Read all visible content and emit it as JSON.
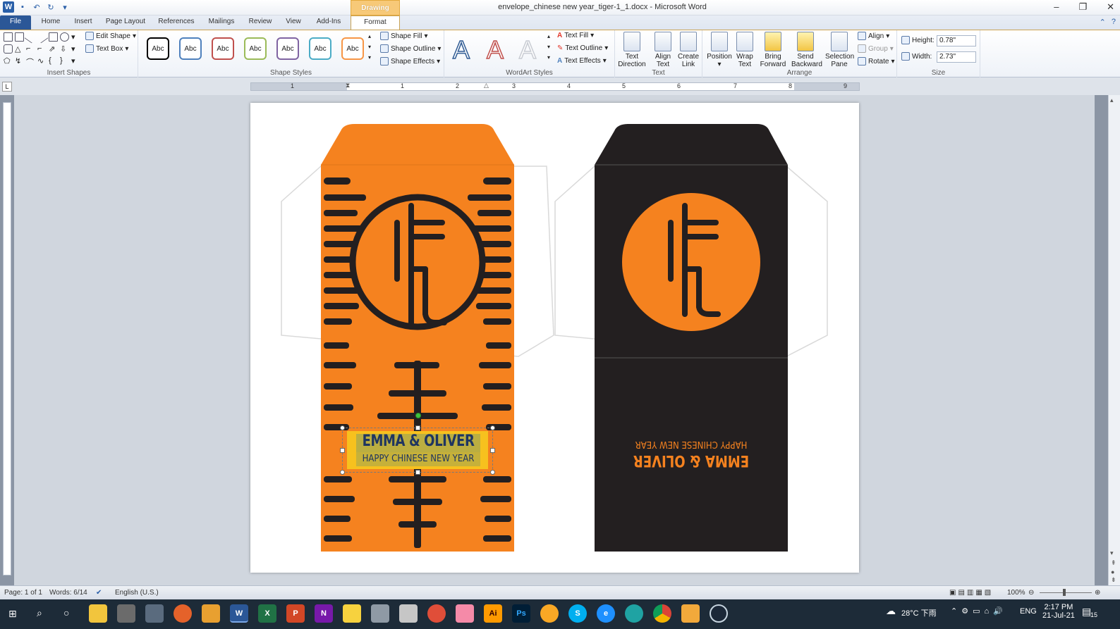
{
  "window": {
    "title": "envelope_chinese new year_tiger-1_1.docx  -  Microsoft Word",
    "contextual_tab_group": "Drawing Tools"
  },
  "tabs": [
    "File",
    "Home",
    "Insert",
    "Page Layout",
    "References",
    "Mailings",
    "Review",
    "View",
    "Add-Ins",
    "Format"
  ],
  "ribbon": {
    "insert_shapes": {
      "edit_shape": "Edit Shape",
      "text_box": "Text Box",
      "label": "Insert Shapes"
    },
    "shape_styles": {
      "samples": [
        "Abc",
        "Abc",
        "Abc",
        "Abc",
        "Abc",
        "Abc",
        "Abc"
      ],
      "sample_colors": [
        "#000000",
        "#4f81bd",
        "#c0504d",
        "#9bbb59",
        "#8064a2",
        "#4bacc6",
        "#f79646"
      ],
      "shape_fill": "Shape Fill",
      "shape_outline": "Shape Outline",
      "shape_effects": "Shape Effects",
      "label": "Shape Styles"
    },
    "wordart_styles": {
      "letters": [
        "A",
        "A",
        "A"
      ],
      "text_fill": "Text Fill",
      "text_outline": "Text Outline",
      "text_effects": "Text Effects",
      "label": "WordArt Styles"
    },
    "text": {
      "text_direction": [
        "Text",
        "Direction"
      ],
      "align_text": [
        "Align",
        "Text"
      ],
      "create_link": [
        "Create",
        "Link"
      ],
      "label": "Text"
    },
    "arrange": {
      "position": "Position",
      "wrap_text": [
        "Wrap",
        "Text"
      ],
      "bring_forward": [
        "Bring",
        "Forward"
      ],
      "send_backward": [
        "Send",
        "Backward"
      ],
      "selection_pane": [
        "Selection",
        "Pane"
      ],
      "align": "Align",
      "group": "Group",
      "rotate": "Rotate",
      "label": "Arrange"
    },
    "size": {
      "height_label": "Height:",
      "height_value": "0.78\"",
      "width_label": "Width:",
      "width_value": "2.73\"",
      "label": "Size"
    }
  },
  "ruler": {
    "numbers": [
      "1",
      "1",
      "2",
      "3",
      "4",
      "5",
      "6",
      "7",
      "8",
      "9"
    ]
  },
  "document": {
    "front_envelope": {
      "names": "EMMA & OLIVER",
      "greeting": "HAPPY CHINESE NEW YEAR",
      "accent_color": "#f5821f",
      "stripe_color": "#231f20",
      "label_bg": "#f7c11e"
    },
    "back_envelope": {
      "names": "EMMA & OLIVER",
      "greeting": "HAPPY CHINESE NEW YEAR",
      "bg_color": "#231f20",
      "accent_color": "#f5821f"
    }
  },
  "status": {
    "page": "Page: 1 of 1",
    "words": "Words: 6/14",
    "language": "English (U.S.)",
    "zoom": "100%"
  },
  "taskbar": {
    "weather": "28°C  下雨",
    "lang": "ENG",
    "time": "2:17 PM",
    "date": "21-Jul-21",
    "notification_count": "15"
  }
}
